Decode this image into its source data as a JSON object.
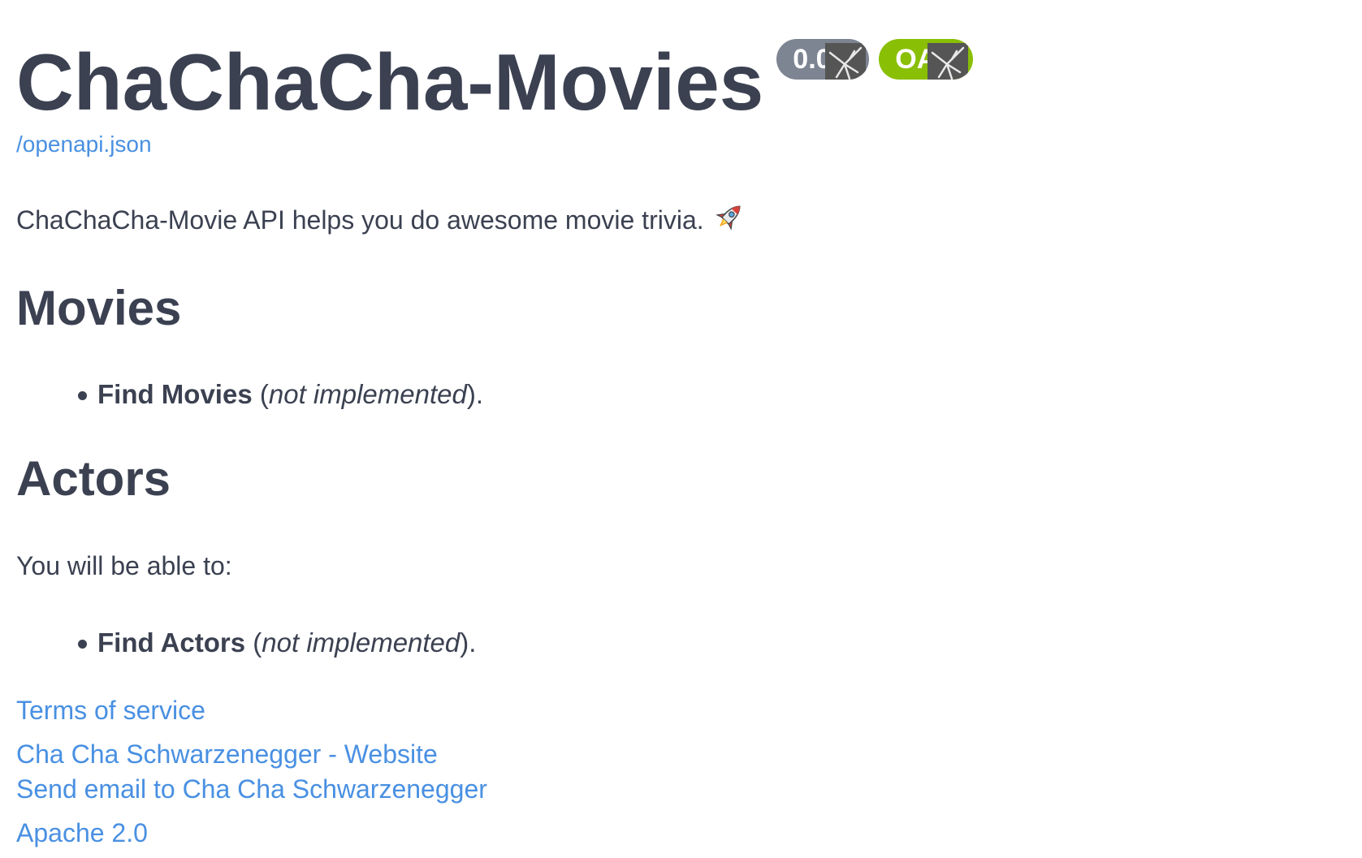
{
  "header": {
    "title": "ChaChaCha-Movies",
    "version_badge": "0.0",
    "oas_badge": "OAS"
  },
  "spec_link": "/openapi.json",
  "description": "ChaChaCha-Movie API helps you do awesome movie trivia.",
  "sections": {
    "movies": {
      "heading": "Movies",
      "items": [
        {
          "bold": "Find Movies",
          "open": " (",
          "italic": "not implemented",
          "close": ")."
        }
      ]
    },
    "actors": {
      "heading": "Actors",
      "intro": "You will be able to:",
      "items": [
        {
          "bold": "Find Actors",
          "open": " (",
          "italic": "not implemented",
          "close": ")."
        }
      ]
    }
  },
  "footer": {
    "terms": "Terms of service",
    "website": "Cha Cha Schwarzenegger - Website",
    "email": "Send email to Cha Cha Schwarzenegger",
    "license": "Apache 2.0"
  },
  "colors": {
    "text": "#3b4151",
    "link": "#4990e2",
    "version_badge": "#7d8492",
    "oas_badge": "#89bf04"
  },
  "icons": [
    "rocket-icon",
    "broken-image-icon"
  ]
}
